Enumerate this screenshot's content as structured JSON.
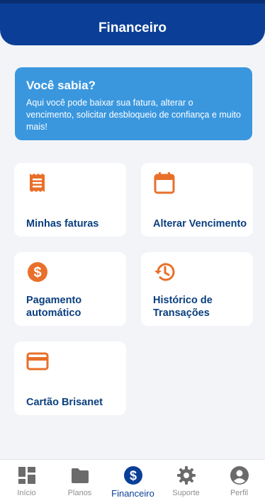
{
  "header": {
    "title": "Financeiro"
  },
  "info_card": {
    "title": "Você sabia?",
    "text": "Aqui você pode baixar sua fatura, alterar o vencimento, solicitar desbloqueio de confiança e muito mais!"
  },
  "tiles": [
    {
      "label": "Minhas faturas",
      "icon": "receipt-icon"
    },
    {
      "label": "Alterar Vencimento",
      "icon": "calendar-icon"
    },
    {
      "label": "Pagamento automático",
      "icon": "dollar-coin-icon"
    },
    {
      "label": "Histórico de Transações",
      "icon": "history-icon"
    },
    {
      "label": "Cartão Brisanet",
      "icon": "credit-card-icon"
    }
  ],
  "nav": [
    {
      "label": "Início",
      "icon": "dashboard-icon"
    },
    {
      "label": "Planos",
      "icon": "folder-icon"
    },
    {
      "label": "Financeiro",
      "icon": "dollar-coin-icon",
      "active": true
    },
    {
      "label": "Suporte",
      "icon": "gear-icon"
    },
    {
      "label": "Perfil",
      "icon": "user-circle-icon"
    }
  ],
  "colors": {
    "primary": "#0b3f97",
    "accent": "#e8702a",
    "info": "#3a97de",
    "nav_inactive": "#6b6b6b"
  }
}
